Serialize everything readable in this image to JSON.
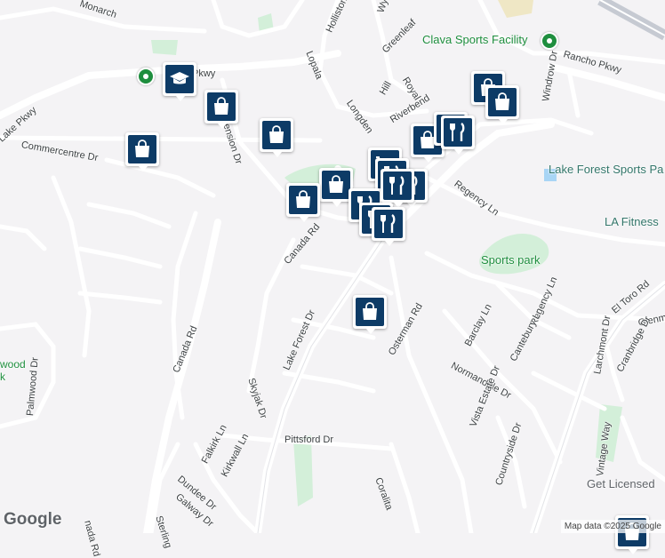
{
  "map": {
    "attribution": "Map data ©2025 Google",
    "logo": "Google",
    "colors": {
      "background": "#f4f3f5",
      "road": "#ffffff",
      "highway": "#c6cad2",
      "park": "#d3efd9",
      "pin": "#0d3b66",
      "poi_green": "#1e8e3e"
    }
  },
  "street_labels": [
    {
      "id": "monarch",
      "text": "Monarch"
    },
    {
      "id": "parkway",
      "text": "Pkwy"
    },
    {
      "id": "lake-pkwy",
      "text": "Lake Pkwy"
    },
    {
      "id": "commercentre",
      "text": "Commercentre Dr"
    },
    {
      "id": "holliston",
      "text": "Holliston"
    },
    {
      "id": "way",
      "text": "Wy"
    },
    {
      "id": "lopala",
      "text": "Lopala"
    },
    {
      "id": "greenleaf",
      "text": "Greenleaf"
    },
    {
      "id": "hill",
      "text": "Hill"
    },
    {
      "id": "royal",
      "text": "Royal"
    },
    {
      "id": "longden",
      "text": "Longden"
    },
    {
      "id": "riverbend",
      "text": "Riverbend"
    },
    {
      "id": "dimension",
      "text": "Dimension Dr"
    },
    {
      "id": "rancho",
      "text": "Rancho Pkwy"
    },
    {
      "id": "windrow",
      "text": "Windrow Dr"
    },
    {
      "id": "regency-ln",
      "text": "Regency Ln"
    },
    {
      "id": "canada-rd-top",
      "text": "Canada Rd"
    },
    {
      "id": "lake-forest",
      "text": "Lake Forest Dr"
    },
    {
      "id": "osterman",
      "text": "Osterman Rd"
    },
    {
      "id": "barclay",
      "text": "Barclay Ln"
    },
    {
      "id": "regency-ln2",
      "text": "Regency Ln"
    },
    {
      "id": "cantebury",
      "text": "Cantebury Ln"
    },
    {
      "id": "normandale",
      "text": "Normandale Dr"
    },
    {
      "id": "el-toro",
      "text": "El Toro Rd"
    },
    {
      "id": "glenmere",
      "text": "Glenmere"
    },
    {
      "id": "larchmont",
      "text": "Larchmont Dr"
    },
    {
      "id": "cranbridge",
      "text": "Cranbridge Dr"
    },
    {
      "id": "canada-rd",
      "text": "Canada Rd"
    },
    {
      "id": "skyjak",
      "text": "Skyjak Dr"
    },
    {
      "id": "palmwood",
      "text": "Palmwood Dr"
    },
    {
      "id": "palmwood-area",
      "text": "wood"
    },
    {
      "id": "palmwood-area2",
      "text": "k"
    },
    {
      "id": "vista-estate",
      "text": "Vista Estate Dr"
    },
    {
      "id": "countryside",
      "text": "Countryside Dr"
    },
    {
      "id": "vintage",
      "text": "Vintage Way"
    },
    {
      "id": "pittsford",
      "text": "Pittsford Dr"
    },
    {
      "id": "falkirk",
      "text": "Falkirk Ln"
    },
    {
      "id": "kirkwall",
      "text": "Kirkwall Ln"
    },
    {
      "id": "dundee",
      "text": "Dundee Dr"
    },
    {
      "id": "galway",
      "text": "Galway Dr"
    },
    {
      "id": "coralita",
      "text": "Coralita"
    },
    {
      "id": "sterling",
      "text": "Sterling"
    },
    {
      "id": "canada-bottom",
      "text": "nada Rd"
    }
  ],
  "places": [
    {
      "id": "clava",
      "text": "Clava Sports Facility",
      "kind": "green"
    },
    {
      "id": "lf-sports",
      "text": "Lake Forest Sports Pa",
      "kind": "teal"
    },
    {
      "id": "la-fitness",
      "text": "LA Fitness",
      "kind": "teal"
    },
    {
      "id": "sports-park",
      "text": "Sports park",
      "kind": "green"
    },
    {
      "id": "get-licensed",
      "text": "Get Licensed",
      "kind": "gray"
    }
  ],
  "markers": [
    {
      "type": "school"
    },
    {
      "type": "shopping"
    },
    {
      "type": "shopping"
    },
    {
      "type": "shopping"
    },
    {
      "type": "shopping"
    },
    {
      "type": "shopping"
    },
    {
      "type": "shopping"
    },
    {
      "type": "shopping"
    },
    {
      "type": "shopping"
    },
    {
      "type": "shopping"
    },
    {
      "type": "shopping"
    },
    {
      "type": "grocery"
    },
    {
      "type": "restaurant"
    },
    {
      "type": "restaurant"
    },
    {
      "type": "restaurant"
    },
    {
      "type": "restaurant"
    },
    {
      "type": "restaurant"
    },
    {
      "type": "restaurant"
    },
    {
      "type": "restaurant"
    },
    {
      "type": "restaurant"
    }
  ]
}
